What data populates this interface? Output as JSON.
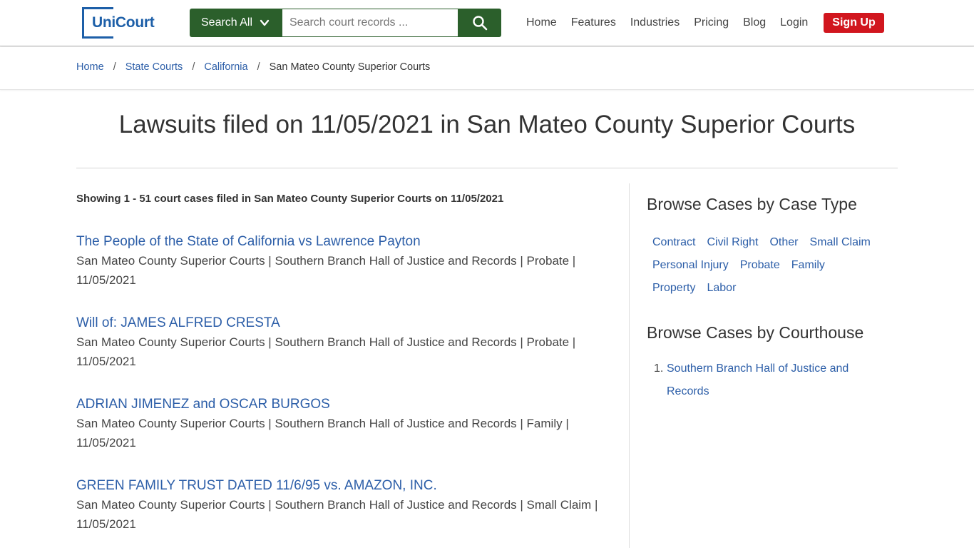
{
  "header": {
    "logo_text": "UniCourt",
    "search_scope": "Search All",
    "search_placeholder": "Search court records ...",
    "nav": [
      "Home",
      "Features",
      "Industries",
      "Pricing",
      "Blog",
      "Login"
    ],
    "signup_label": "Sign Up",
    "colors": {
      "brand": "#1d5fa8",
      "search_green": "#2b5f2b",
      "signup_red": "#d1161e"
    }
  },
  "breadcrumb": {
    "items": [
      "Home",
      "State Courts",
      "California"
    ],
    "current": "San Mateo County Superior Courts",
    "separator": "/"
  },
  "page": {
    "title": "Lawsuits filed on 11/05/2021 in San Mateo County Superior Courts",
    "showing": "Showing 1 - 51 court cases filed in San Mateo County Superior Courts on 11/05/2021"
  },
  "cases": [
    {
      "title": "The People of the State of California vs Lawrence Payton",
      "meta": "San Mateo County Superior Courts | Southern Branch Hall of Justice and Records | Probate | 11/05/2021"
    },
    {
      "title": "Will of: JAMES ALFRED CRESTA",
      "meta": "San Mateo County Superior Courts | Southern Branch Hall of Justice and Records | Probate | 11/05/2021"
    },
    {
      "title": "ADRIAN JIMENEZ and OSCAR BURGOS",
      "meta": "San Mateo County Superior Courts | Southern Branch Hall of Justice and Records | Family | 11/05/2021"
    },
    {
      "title": "GREEN FAMILY TRUST DATED 11/6/95 vs. AMAZON, INC.",
      "meta": "San Mateo County Superior Courts | Southern Branch Hall of Justice and Records | Small Claim | 11/05/2021"
    }
  ],
  "sidebar": {
    "case_type_title": "Browse Cases by Case Type",
    "case_types": [
      "Contract",
      "Civil Right",
      "Other",
      "Small Claim",
      "Personal Injury",
      "Probate",
      "Family",
      "Property",
      "Labor"
    ],
    "courthouse_title": "Browse Cases by Courthouse",
    "courthouses": [
      {
        "num": "1.",
        "name": "Southern Branch Hall of Justice and Records"
      }
    ]
  }
}
